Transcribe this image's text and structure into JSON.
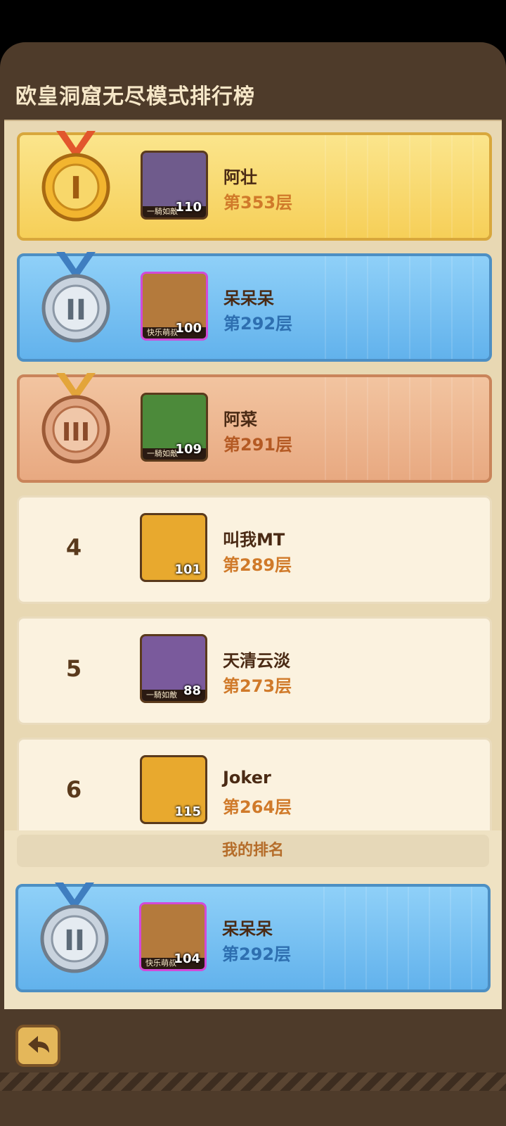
{
  "title": "欧皇洞窟无尽模式排行榜",
  "my_rank_label": "我的排名",
  "entries": [
    {
      "rank": "1",
      "name": "阿壮",
      "floor": "第353层",
      "level": "110",
      "tag": "一騎如敵",
      "tier": "gold"
    },
    {
      "rank": "2",
      "name": "呆呆呆",
      "floor": "第292层",
      "level": "100",
      "tag": "快乐萌叔",
      "tier": "silver"
    },
    {
      "rank": "3",
      "name": "阿菜",
      "floor": "第291层",
      "level": "109",
      "tag": "一騎如敵",
      "tier": "bronze"
    },
    {
      "rank": "4",
      "name": "叫我MT",
      "floor": "第289层",
      "level": "101",
      "tag": "",
      "tier": "plain"
    },
    {
      "rank": "5",
      "name": "天清云淡",
      "floor": "第273层",
      "level": "88",
      "tag": "一騎如敵",
      "tier": "plain"
    },
    {
      "rank": "6",
      "name": "Joker",
      "floor": "第264层",
      "level": "115",
      "tag": "",
      "tier": "plain"
    }
  ],
  "my_entry": {
    "rank": "2",
    "name": "呆呆呆",
    "floor": "第292层",
    "level": "104",
    "tag": "快乐萌叔",
    "tier": "silver"
  },
  "icons": {
    "back": "back-arrow-icon"
  }
}
